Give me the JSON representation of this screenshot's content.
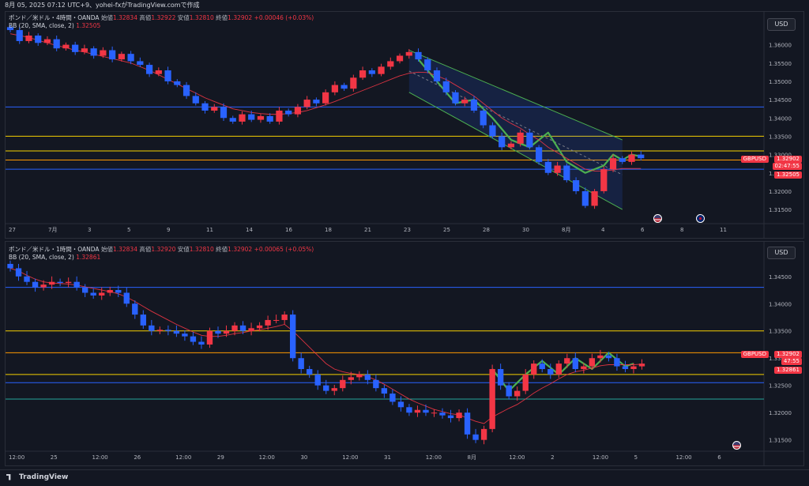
{
  "header": {
    "text": "8月 05, 2025 07:12 UTC+9、yohei-fxがTradingView.comで作成"
  },
  "colors": {
    "background": "#131722",
    "up": "#f23645",
    "down": "#2962ff",
    "bb_basis": "#f23645",
    "channel": "#4caf50",
    "wave": "#4caf50",
    "hline_blue": "#2962ff",
    "hline_yellow": "#f5d000",
    "hline_orange": "#ff9800",
    "hline_teal": "#26a69a"
  },
  "top": {
    "legend": {
      "symbol": "ポンド／米ドル・4時間・OANDA",
      "open_label": "始値",
      "open": "1.32834",
      "high_label": "高値",
      "high": "1.32922",
      "low_label": "安値",
      "low": "1.32810",
      "close_label": "終値",
      "close": "1.32902",
      "change": "+0.00046 (+0.03%)",
      "bb": "BB (20, SMA, close, 2)",
      "bb_value": "1.32505"
    },
    "currency": "USD",
    "ticker": "GBPUSD",
    "price_labels": {
      "last": "1.32902",
      "countdown": "02:47:55",
      "bb": "1.32505"
    }
  },
  "bottom": {
    "legend": {
      "symbol": "ポンド／米ドル・1時間・OANDA",
      "open_label": "始値",
      "open": "1.32834",
      "high_label": "高値",
      "high": "1.32920",
      "low_label": "安値",
      "low": "1.32810",
      "close_label": "終値",
      "close": "1.32902",
      "change": "+0.00065 (+0.05%)",
      "bb": "BB (20, SMA, close, 2)",
      "bb_value": "1.32861"
    },
    "currency": "USD",
    "ticker": "GBPUSD",
    "price_labels": {
      "last": "1.32902",
      "countdown": "47:55",
      "bb": "1.32861"
    }
  },
  "footer": {
    "brand": "TradingView"
  },
  "chart_data": [
    {
      "type": "candlestick",
      "pane": "top",
      "timeframe": "4時間",
      "ylim": [
        1.312,
        1.3625
      ],
      "y_ticks": [
        "1.36000",
        "1.35500",
        "1.35000",
        "1.34500",
        "1.34000",
        "1.33500",
        "1.33000",
        "1.32500",
        "1.32000",
        "1.31500"
      ],
      "x_ticks": [
        "27",
        "7月",
        "3",
        "5",
        "9",
        "11",
        "14",
        "16",
        "18",
        "21",
        "23",
        "25",
        "28",
        "30",
        "8月",
        "4",
        "6",
        "8",
        "11"
      ],
      "hlines": [
        {
          "value": 1.343,
          "color": "hline_blue"
        },
        {
          "value": 1.335,
          "color": "hline_yellow"
        },
        {
          "value": 1.331,
          "color": "hline_yellow"
        },
        {
          "value": 1.3285,
          "color": "hline_orange"
        },
        {
          "value": 1.326,
          "color": "hline_blue"
        }
      ],
      "close_path": [
        1.364,
        1.361,
        1.3625,
        1.3605,
        1.3615,
        1.359,
        1.36,
        1.358,
        1.359,
        1.357,
        1.3585,
        1.356,
        1.3575,
        1.3555,
        1.3545,
        1.352,
        1.353,
        1.35,
        1.349,
        1.346,
        1.344,
        1.342,
        1.343,
        1.34,
        1.339,
        1.341,
        1.3395,
        1.3405,
        1.339,
        1.342,
        1.341,
        1.343,
        1.345,
        1.344,
        1.347,
        1.349,
        1.348,
        1.351,
        1.353,
        1.352,
        1.354,
        1.3555,
        1.357,
        1.358,
        1.356,
        1.353,
        1.35,
        1.347,
        1.344,
        1.345,
        1.342,
        1.338,
        1.335,
        1.332,
        1.333,
        1.336,
        1.332,
        1.328,
        1.325,
        1.327,
        1.323,
        1.32,
        1.316,
        1.32,
        1.326,
        1.329,
        1.328,
        1.33,
        1.329
      ],
      "bb_basis": [
        1.363,
        1.3625,
        1.362,
        1.3612,
        1.3605,
        1.3598,
        1.3592,
        1.3585,
        1.358,
        1.3574,
        1.3568,
        1.3562,
        1.3556,
        1.355,
        1.354,
        1.353,
        1.3518,
        1.3505,
        1.3493,
        1.348,
        1.3468,
        1.3455,
        1.3445,
        1.3435,
        1.3425,
        1.342,
        1.3415,
        1.3412,
        1.341,
        1.341,
        1.3412,
        1.3415,
        1.342,
        1.3428,
        1.3436,
        1.3445,
        1.3455,
        1.3465,
        1.3475,
        1.3485,
        1.3495,
        1.3505,
        1.3515,
        1.3522,
        1.3525,
        1.3524,
        1.3515,
        1.3505,
        1.349,
        1.3475,
        1.346,
        1.344,
        1.342,
        1.34,
        1.3385,
        1.3372,
        1.3355,
        1.334,
        1.332,
        1.3305,
        1.329,
        1.3275,
        1.326,
        1.3255,
        1.3255,
        1.3258,
        1.3262,
        1.3262,
        1.3262
      ]
    },
    {
      "type": "candlestick",
      "pane": "bottom",
      "timeframe": "1時間",
      "ylim": [
        1.3135,
        1.347
      ],
      "y_ticks": [
        "1.34500",
        "1.34000",
        "1.33500",
        "1.33000",
        "1.32500",
        "1.32000",
        "1.31500"
      ],
      "x_ticks": [
        "12:00",
        "25",
        "12:00",
        "26",
        "12:00",
        "29",
        "12:00",
        "30",
        "12:00",
        "31",
        "12:00",
        "8月",
        "12:00",
        "2",
        "12:00",
        "5",
        "12:00",
        "6"
      ],
      "hlines": [
        {
          "value": 1.343,
          "color": "hline_blue"
        },
        {
          "value": 1.335,
          "color": "hline_yellow"
        },
        {
          "value": 1.331,
          "color": "hline_orange"
        },
        {
          "value": 1.327,
          "color": "hline_yellow"
        },
        {
          "value": 1.3255,
          "color": "hline_blue"
        },
        {
          "value": 1.3225,
          "color": "hline_teal"
        }
      ],
      "close_path": [
        1.3465,
        1.345,
        1.344,
        1.343,
        1.3435,
        1.344,
        1.3438,
        1.344,
        1.343,
        1.342,
        1.3415,
        1.342,
        1.3425,
        1.342,
        1.34,
        1.338,
        1.336,
        1.335,
        1.3352,
        1.335,
        1.3345,
        1.334,
        1.333,
        1.3325,
        1.335,
        1.3345,
        1.335,
        1.336,
        1.335,
        1.3355,
        1.336,
        1.337,
        1.337,
        1.338,
        1.33,
        1.328,
        1.327,
        1.325,
        1.324,
        1.3245,
        1.326,
        1.3265,
        1.327,
        1.326,
        1.3245,
        1.3235,
        1.322,
        1.321,
        1.32,
        1.3205,
        1.32,
        1.32,
        1.3195,
        1.319,
        1.32,
        1.316,
        1.315,
        1.317,
        1.328,
        1.325,
        1.323,
        1.324,
        1.327,
        1.329,
        1.328,
        1.327,
        1.329,
        1.33,
        1.328,
        1.3285,
        1.33,
        1.3305,
        1.33,
        1.3285,
        1.328,
        1.3285,
        1.329
      ],
      "bb_basis": [
        1.3465,
        1.346,
        1.3452,
        1.3445,
        1.344,
        1.3438,
        1.3437,
        1.3436,
        1.3434,
        1.3431,
        1.3428,
        1.3425,
        1.3422,
        1.3418,
        1.3412,
        1.3404,
        1.3395,
        1.3386,
        1.3378,
        1.337,
        1.3362,
        1.3355,
        1.3348,
        1.3342,
        1.334,
        1.334,
        1.3342,
        1.3345,
        1.3347,
        1.335,
        1.3352,
        1.3355,
        1.3358,
        1.3362,
        1.335,
        1.3335,
        1.332,
        1.3305,
        1.329,
        1.328,
        1.3275,
        1.3272,
        1.327,
        1.3266,
        1.326,
        1.3252,
        1.3243,
        1.3234,
        1.3225,
        1.3218,
        1.3212,
        1.3206,
        1.3202,
        1.3198,
        1.3196,
        1.319,
        1.3184,
        1.318,
        1.3192,
        1.32,
        1.3208,
        1.3215,
        1.3225,
        1.3236,
        1.3245,
        1.3253,
        1.3262,
        1.327,
        1.3275,
        1.3278,
        1.3282,
        1.3286,
        1.3288,
        1.3288,
        1.3288,
        1.3288,
        1.3289
      ]
    }
  ]
}
